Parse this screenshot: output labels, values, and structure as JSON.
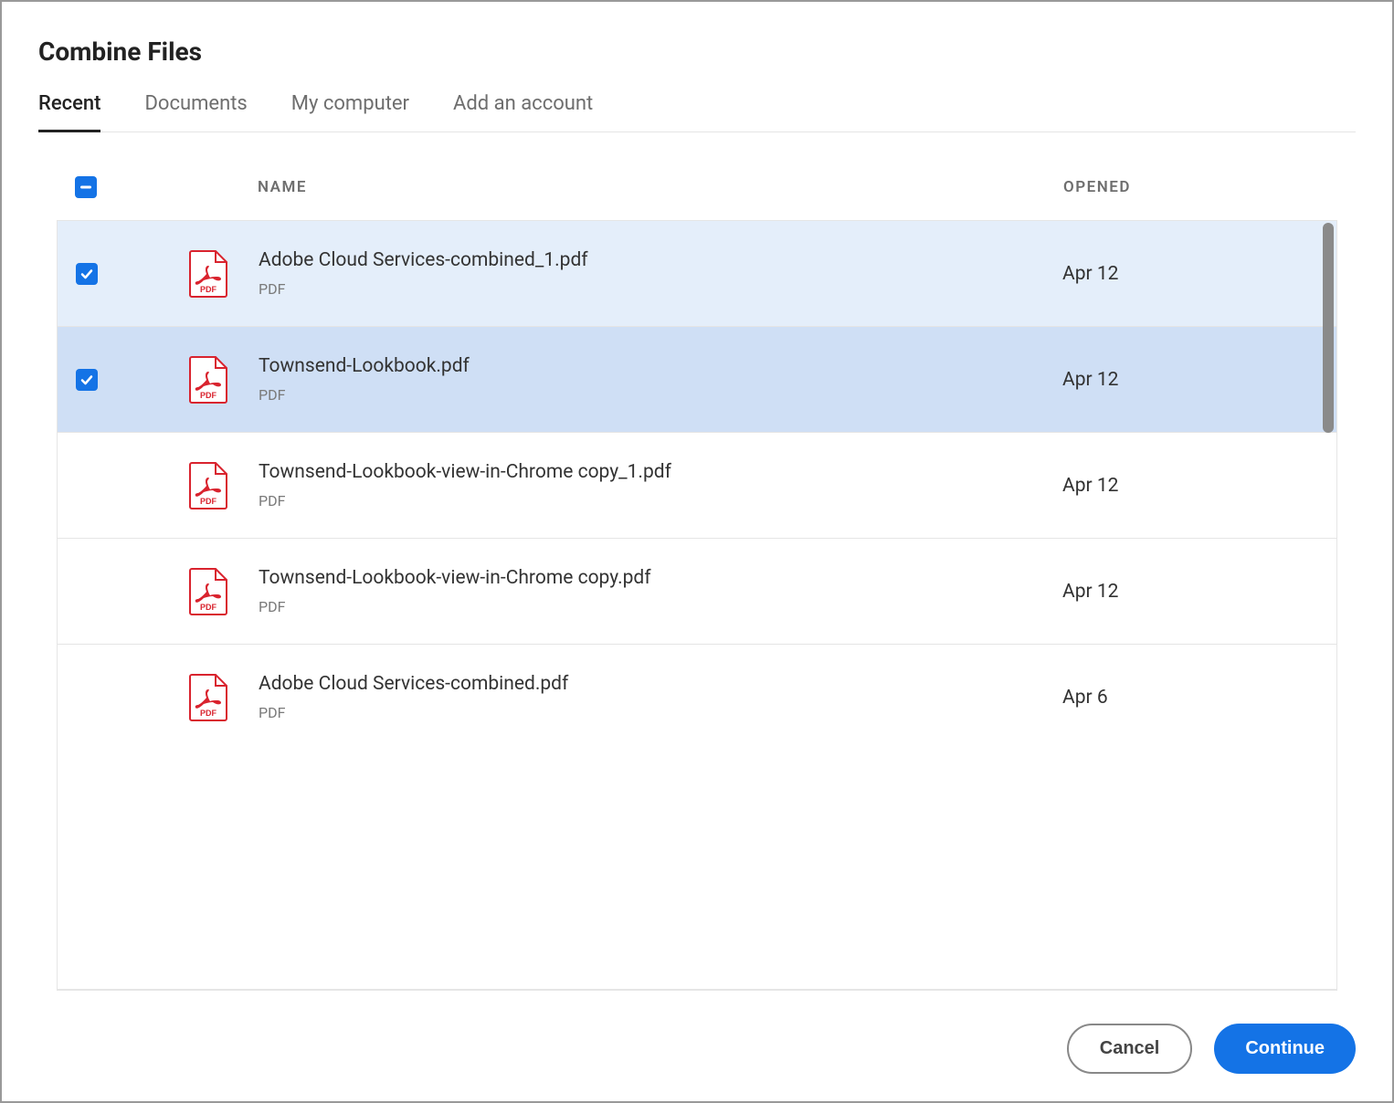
{
  "dialog": {
    "title": "Combine Files"
  },
  "tabs": [
    {
      "label": "Recent",
      "active": true
    },
    {
      "label": "Documents",
      "active": false
    },
    {
      "label": "My computer",
      "active": false
    },
    {
      "label": "Add an account",
      "active": false
    }
  ],
  "columns": {
    "name": "NAME",
    "opened": "OPENED"
  },
  "header_checkbox_state": "indeterminate",
  "files": [
    {
      "name": "Adobe Cloud Services-combined_1.pdf",
      "type": "PDF",
      "opened": "Apr 12",
      "checked": true,
      "selection": "light"
    },
    {
      "name": "Townsend-Lookbook.pdf",
      "type": "PDF",
      "opened": "Apr 12",
      "checked": true,
      "selection": "dark"
    },
    {
      "name": "Townsend-Lookbook-view-in-Chrome copy_1.pdf",
      "type": "PDF",
      "opened": "Apr 12",
      "checked": false,
      "selection": "none"
    },
    {
      "name": "Townsend-Lookbook-view-in-Chrome copy.pdf",
      "type": "PDF",
      "opened": "Apr 12",
      "checked": false,
      "selection": "none"
    },
    {
      "name": "Adobe Cloud Services-combined.pdf",
      "type": "PDF",
      "opened": "Apr 6",
      "checked": false,
      "selection": "none"
    }
  ],
  "footer": {
    "cancel": "Cancel",
    "continue": "Continue"
  }
}
